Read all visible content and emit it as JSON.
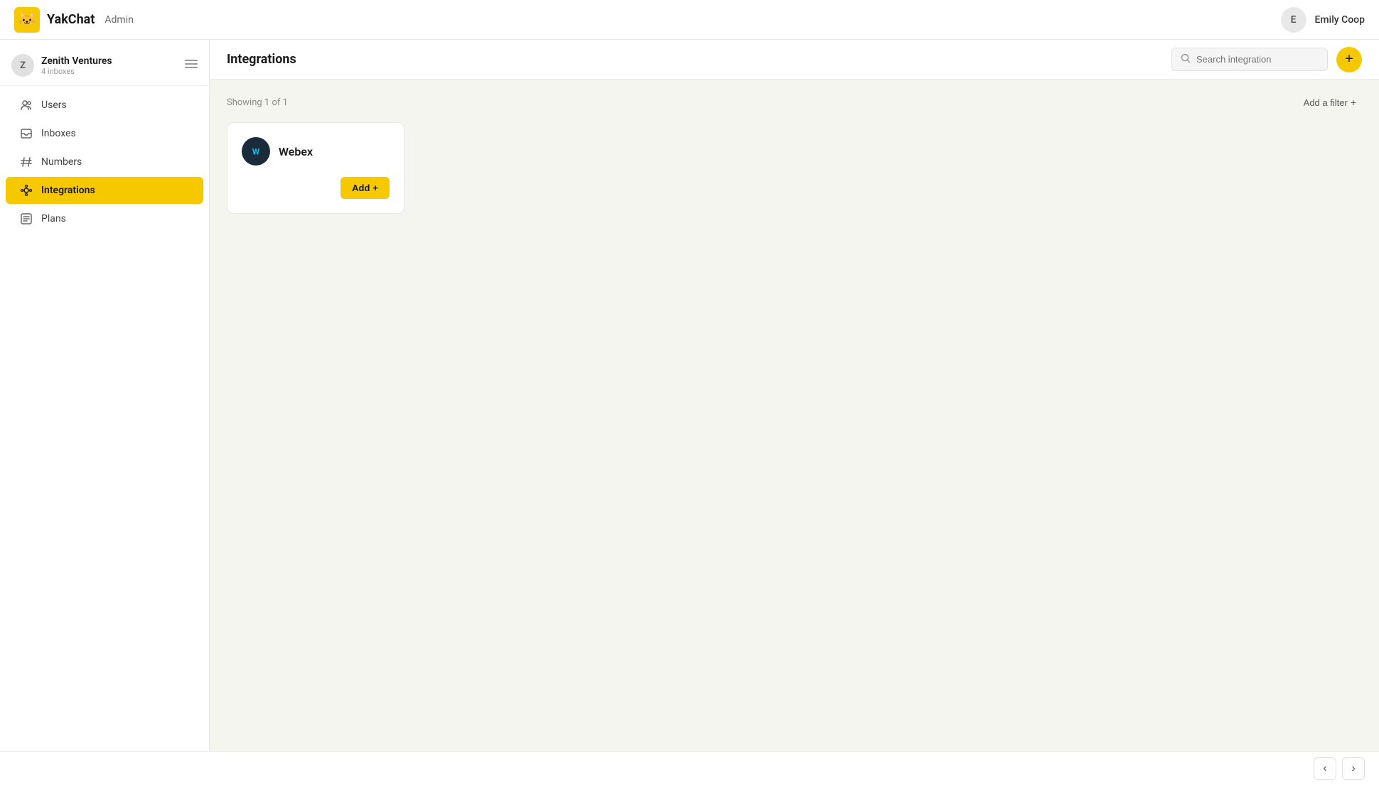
{
  "app": {
    "name": "YakChat",
    "admin_label": "Admin"
  },
  "user": {
    "name": "Emily Coop",
    "avatar_letter": "E"
  },
  "workspace": {
    "name": "Zenith Ventures",
    "inboxes": "4 inboxes",
    "avatar_letter": "Z"
  },
  "sidebar": {
    "nav_items": [
      {
        "id": "users",
        "label": "Users",
        "active": false
      },
      {
        "id": "inboxes",
        "label": "Inboxes",
        "active": false
      },
      {
        "id": "numbers",
        "label": "Numbers",
        "active": false
      },
      {
        "id": "integrations",
        "label": "Integrations",
        "active": true
      },
      {
        "id": "plans",
        "label": "Plans",
        "active": false
      }
    ]
  },
  "content": {
    "page_title": "Integrations",
    "search_placeholder": "Search integration",
    "results_text": "Showing 1 of 1",
    "add_filter_label": "Add a filter",
    "add_button_label": "+"
  },
  "integrations": [
    {
      "id": "webex",
      "name": "Webex",
      "add_label": "Add"
    }
  ],
  "bottom_nav": {
    "prev_arrow": "‹",
    "next_arrow": "›"
  }
}
